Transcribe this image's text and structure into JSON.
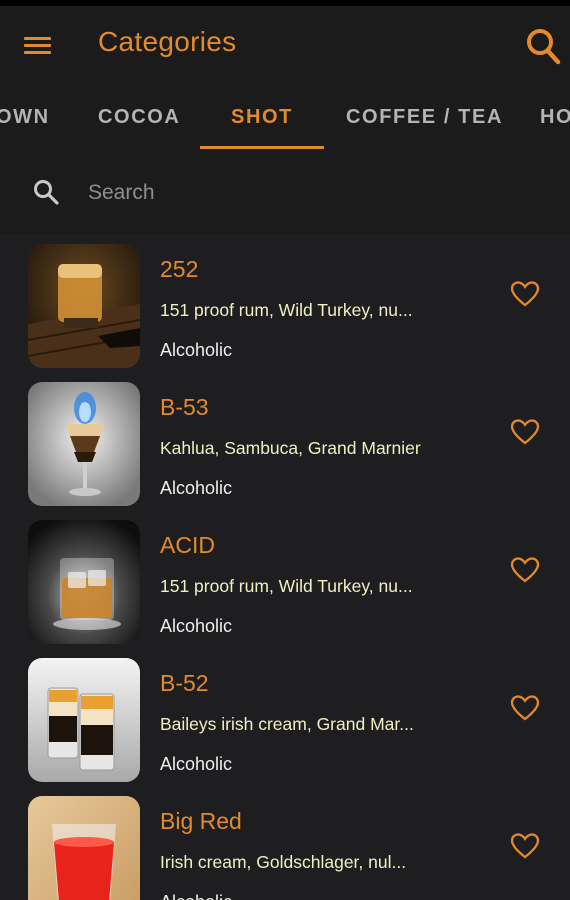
{
  "header": {
    "title": "Categories",
    "menu_icon": "hamburger-menu-icon",
    "search_icon": "search-icon"
  },
  "tabs": [
    {
      "label": "OWN",
      "active": false
    },
    {
      "label": "COCOA",
      "active": false
    },
    {
      "label": "SHOT",
      "active": true
    },
    {
      "label": "COFFEE / TEA",
      "active": false
    },
    {
      "label": "HO",
      "active": false
    }
  ],
  "search": {
    "placeholder": "Search",
    "value": ""
  },
  "drinks": [
    {
      "name": "252",
      "ingredients": "151 proof rum, Wild Turkey, nu...",
      "category": "Alcoholic",
      "favorite_icon": "heart-outline-icon"
    },
    {
      "name": "B-53",
      "ingredients": "Kahlua, Sambuca, Grand Marnier",
      "category": "Alcoholic",
      "favorite_icon": "heart-outline-icon"
    },
    {
      "name": "ACID",
      "ingredients": "151 proof rum, Wild Turkey, nu...",
      "category": "Alcoholic",
      "favorite_icon": "heart-outline-icon"
    },
    {
      "name": "B-52",
      "ingredients": "Baileys irish cream, Grand Mar...",
      "category": "Alcoholic",
      "favorite_icon": "heart-outline-icon"
    },
    {
      "name": "Big Red",
      "ingredients": "Irish cream, Goldschlager, nul...",
      "category": "Alcoholic",
      "favorite_icon": "heart-outline-icon"
    }
  ],
  "colors": {
    "accent": "#e58a2c",
    "background": "#1e1e20",
    "toolbar": "#1b1b1b",
    "ingredients_text": "#f1efc4"
  }
}
